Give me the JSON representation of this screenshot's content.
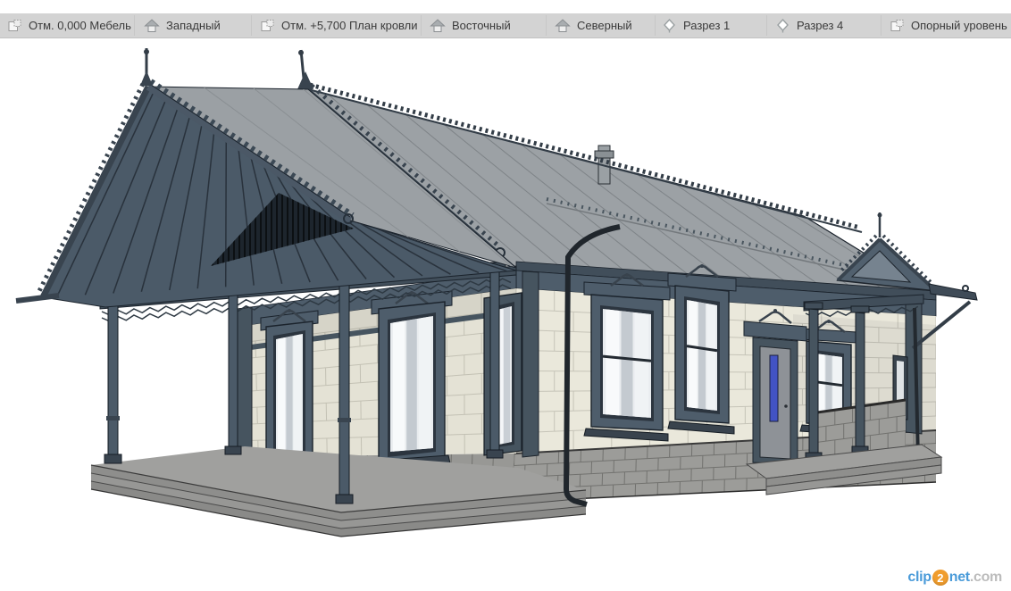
{
  "view_tabs": {
    "items": [
      {
        "label": "Отм. 0,000 Мебель",
        "icon": "floor-plan-icon"
      },
      {
        "label": "Западный",
        "icon": "elevation-icon"
      },
      {
        "label": "Отм. +5,700 План кровли",
        "icon": "floor-plan-icon"
      },
      {
        "label": "Восточный",
        "icon": "elevation-icon"
      },
      {
        "label": "Северный",
        "icon": "elevation-icon"
      },
      {
        "label": "Разрез 1",
        "icon": "section-icon"
      },
      {
        "label": "Разрез 4",
        "icon": "section-icon"
      },
      {
        "label": "Опорный уровень",
        "icon": "floor-plan-icon"
      }
    ]
  },
  "viewport": {
    "colors": {
      "trim_dark_blue_gray": "#4e5d6b",
      "roof_metal_gray": "#9ca1a5",
      "wall_cream": "#eae8db",
      "stone_base_gray": "#9c9c99",
      "platform_gray": "#a0a09e",
      "door_glass_blue": "#4253c4",
      "outline_black": "#1a222b"
    }
  },
  "watermark": {
    "clip": "clip",
    "two": "2",
    "net": "net",
    "dotcom": ".com"
  }
}
